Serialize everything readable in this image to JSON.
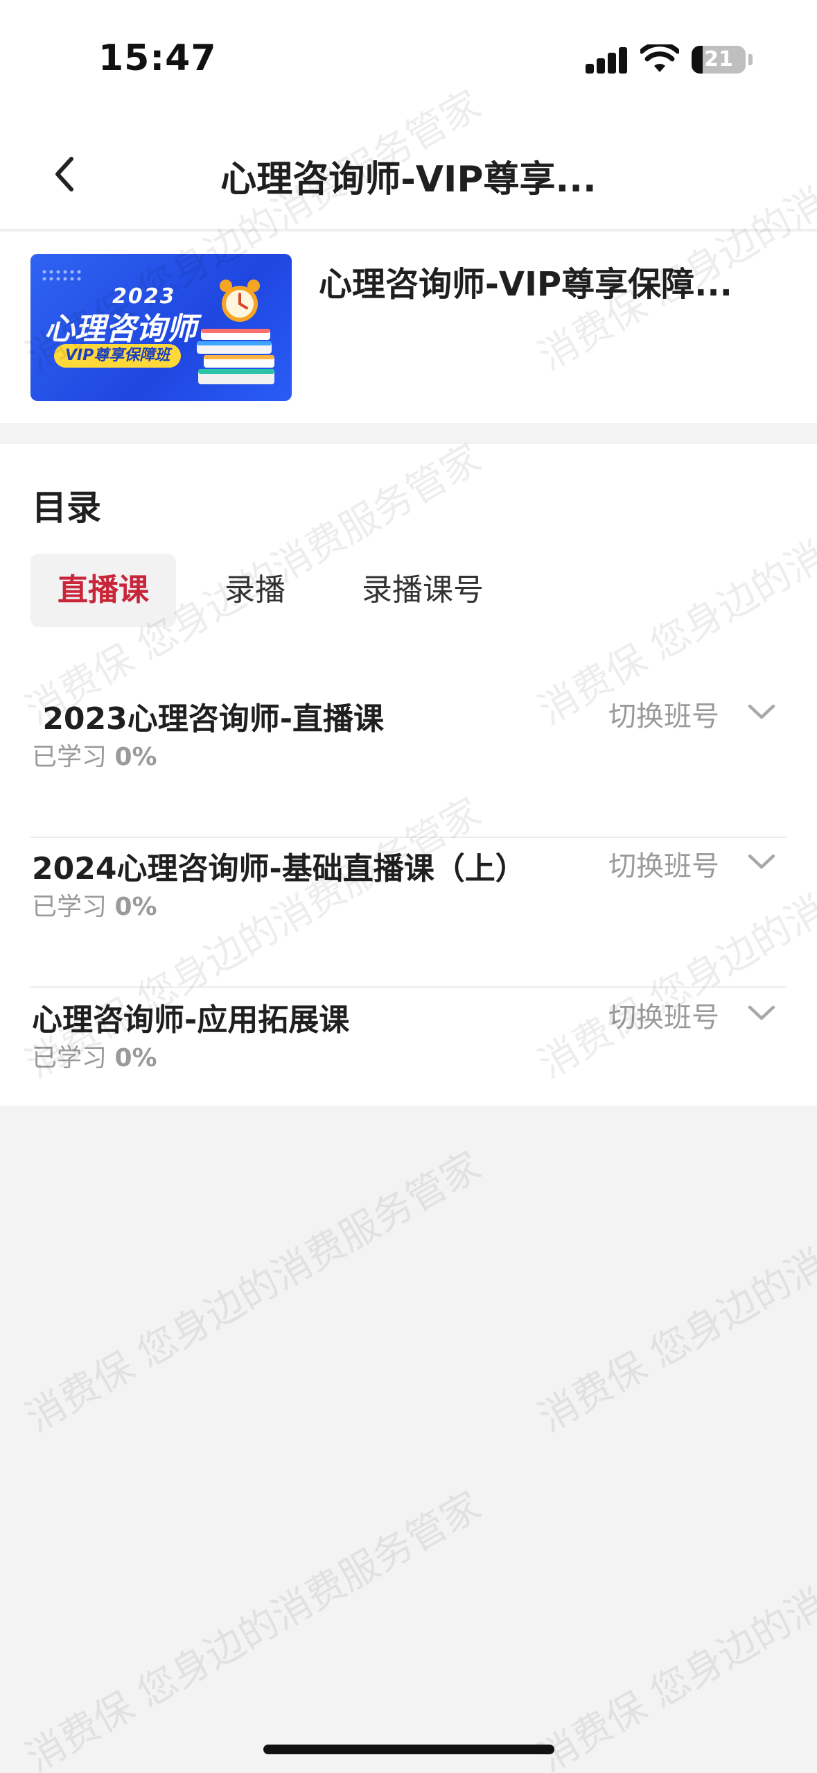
{
  "status_bar": {
    "time": "15:47",
    "battery_level": "21",
    "battery_fraction": 0.21
  },
  "header": {
    "title": "心理咨询师-VIP尊享...",
    "back_icon": "chevron-left-icon"
  },
  "course": {
    "title": "心理咨询师-VIP尊享保障...",
    "thumbnail": {
      "year": "2023",
      "name": "心理咨询师",
      "badge": "VIP尊享保障班"
    }
  },
  "catalog": {
    "title": "目录",
    "tabs": [
      {
        "label": "直播课",
        "active": true
      },
      {
        "label": "录播",
        "active": false
      },
      {
        "label": "录播课号",
        "active": false
      }
    ],
    "items": [
      {
        "title": " 2023心理咨询师-直播课",
        "progress_label": "已学习",
        "progress_value": "0%",
        "switch_label": "切换班号"
      },
      {
        "title": "2024心理咨询师-基础直播课（上）",
        "progress_label": "已学习",
        "progress_value": "0%",
        "switch_label": "切换班号"
      },
      {
        "title": "心理咨询师-应用拓展课",
        "progress_label": "已学习",
        "progress_value": "0%",
        "switch_label": "切换班号"
      }
    ]
  },
  "watermark": {
    "line_a": "消费保 您身边的消费服务管家",
    "line_b": "消费保 您身边的消费服务管家"
  },
  "colors": {
    "accent": "#c8263a",
    "muted": "#9a9a9a",
    "page_bg": "#f3f3f3"
  }
}
